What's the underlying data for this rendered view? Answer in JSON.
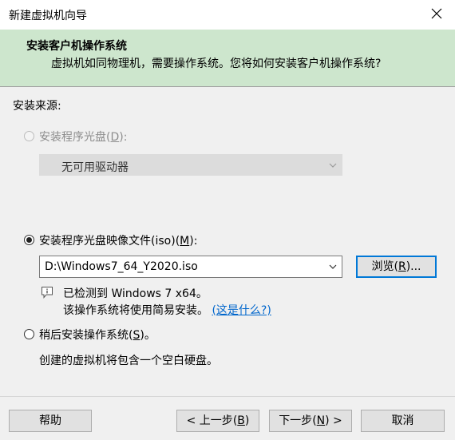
{
  "window": {
    "title": "新建虚拟机向导"
  },
  "header": {
    "title": "安装客户机操作系统",
    "subtitle": "虚拟机如同物理机，需要操作系统。您将如何安装客户机操作系统?"
  },
  "source_label": "安装来源:",
  "option_disc": {
    "label": "安装程序光盘",
    "mnemonic": "D",
    "suffix": ":",
    "drive_value": "无可用驱动器",
    "selected": false,
    "enabled": false
  },
  "option_iso": {
    "label": "安装程序光盘映像文件(iso)",
    "mnemonic": "M",
    "suffix": ":",
    "path": "D:\\Windows7_64_Y2020.iso",
    "selected": true
  },
  "browse_button": {
    "label": "浏览",
    "mnemonic": "R",
    "suffix": "..."
  },
  "detect": {
    "line1": "已检测到 Windows 7 x64。",
    "line2": "该操作系统将使用简易安装。",
    "link": "(这是什么?)"
  },
  "option_later": {
    "label": "稍后安装操作系统",
    "mnemonic": "S",
    "suffix": "。",
    "selected": false,
    "note": "创建的虚拟机将包含一个空白硬盘。"
  },
  "footer": {
    "help": "帮助",
    "back": {
      "label": "< 上一步",
      "mnemonic": "B"
    },
    "next": {
      "label": "下一步",
      "mnemonic": "N",
      "suffix": " >"
    },
    "cancel": "取消"
  }
}
